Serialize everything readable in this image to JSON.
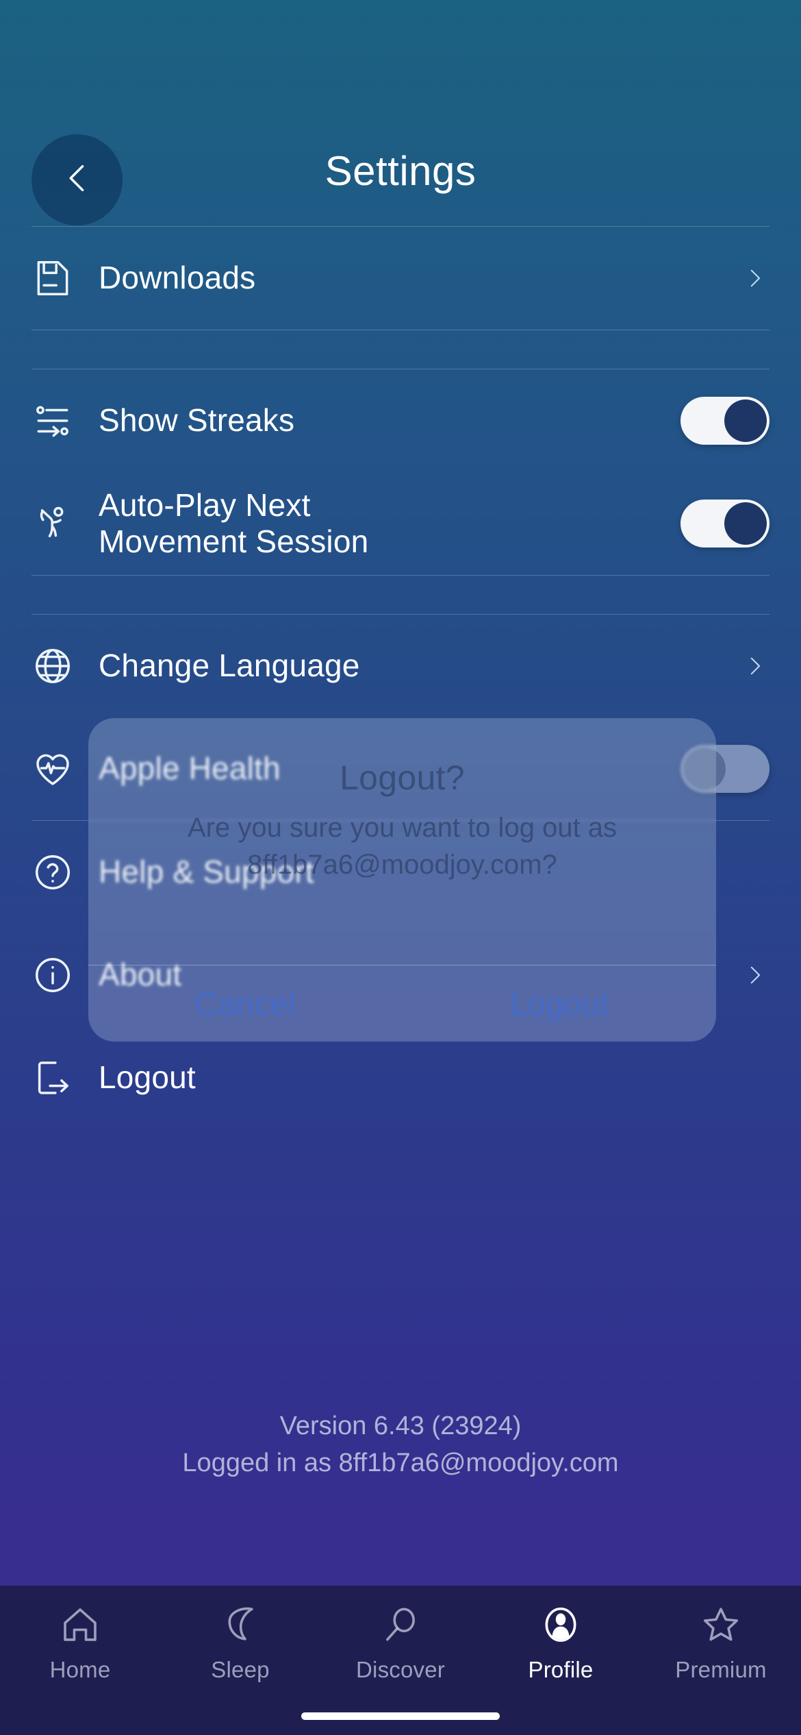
{
  "header": {
    "title": "Settings",
    "back_icon": "chevron-left-icon"
  },
  "settings": {
    "downloads": {
      "label": "Downloads",
      "icon": "document-save-icon",
      "accessory": "chevron-right-icon"
    },
    "show_streaks": {
      "label": "Show Streaks",
      "icon": "streaks-list-icon",
      "toggle_state": "on"
    },
    "auto_play": {
      "label": "Auto-Play Next Movement Session",
      "label_line1": "Auto-Play Next",
      "label_line2": "Movement Session",
      "icon": "movement-person-icon",
      "toggle_state": "on"
    },
    "change_language": {
      "label": "Change Language",
      "icon": "globe-icon",
      "accessory": "chevron-right-icon"
    },
    "apple_health": {
      "label": "Apple Health",
      "icon": "heart-pulse-icon",
      "toggle_state": "off"
    },
    "help_support": {
      "label": "Help & Support",
      "icon": "question-circle-icon"
    },
    "about": {
      "label": "About",
      "icon": "info-circle-icon",
      "accessory": "chevron-right-icon"
    },
    "logout": {
      "label": "Logout",
      "icon": "logout-exit-icon"
    }
  },
  "footer": {
    "version": "Version 6.43 (23924)",
    "logged_in_as": "Logged in as 8ff1b7a6@moodjoy.com"
  },
  "logout_dialog": {
    "title": "Logout?",
    "message": "Are you sure you want to log out as 8ff1b7a6@moodjoy.com?",
    "cancel_label": "Cancel",
    "confirm_label": "Logout"
  },
  "tabbar": {
    "tabs": [
      {
        "label": "Home",
        "icon": "house-icon",
        "active": false
      },
      {
        "label": "Sleep",
        "icon": "moon-icon",
        "active": false
      },
      {
        "label": "Discover",
        "icon": "magnifier-icon",
        "active": false
      },
      {
        "label": "Profile",
        "icon": "person-filled-icon",
        "active": true
      },
      {
        "label": "Premium",
        "icon": "star-icon",
        "active": false
      }
    ]
  },
  "colors": {
    "gradient_top": "#1b6182",
    "gradient_bottom": "#3d2a90",
    "tabbar_bg": "#1e1f50",
    "toggle_on_track": "#f3f5f8",
    "toggle_on_knob": "#1e3666",
    "dialog_action_blue": "#3c6ee1"
  }
}
